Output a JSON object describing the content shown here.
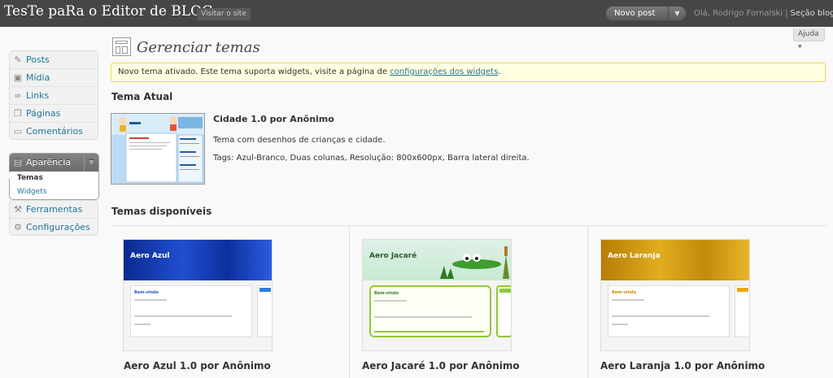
{
  "header": {
    "site_title": "TesTe paRa o Editor de BLOGs",
    "visit_site": "Visitar o site",
    "new_post": "Novo post",
    "greeting": "Olá, Rodrigo Fornalski",
    "separator": "|",
    "logout": "Seção blog"
  },
  "sidebar": {
    "items": [
      {
        "label": "Posts",
        "icon": "pin-icon"
      },
      {
        "label": "Mídia",
        "icon": "media-icon"
      },
      {
        "label": "Links",
        "icon": "links-icon"
      },
      {
        "label": "Páginas",
        "icon": "pages-icon"
      },
      {
        "label": "Comentários",
        "icon": "comments-icon"
      }
    ],
    "appearance": {
      "label": "Aparência",
      "submenu": [
        "Temas",
        "Widgets"
      ]
    },
    "bottom_items": [
      {
        "label": "Ferramentas",
        "icon": "tools-icon"
      },
      {
        "label": "Configurações",
        "icon": "settings-icon"
      }
    ]
  },
  "main": {
    "page_title": "Gerenciar temas",
    "help": "Ajuda",
    "notice": {
      "text": "Novo tema ativado. Este tema suporta widgets, visite a página de ",
      "link": "configurações dos widgets",
      "end": "."
    },
    "current_theme": {
      "heading": "Tema Atual",
      "name": "Cidade 1.0 por Anônimo",
      "description": "Tema com desenhos de crianças e cidade.",
      "tags": "Tags: Azul-Branco, Duas colunas, Resolução: 800x600px, Barra lateral direita."
    },
    "available_heading": "Temas disponíveis",
    "themes": [
      {
        "name": "Aero Azul 1.0 por Anônimo",
        "thumb_title": "Aero Azul",
        "post_title": "Bem-vindo",
        "accent": "#1a3fae"
      },
      {
        "name": "Aero Jacaré 1.0 por Anônimo",
        "thumb_title": "Aero Jacaré",
        "post_title": "Bem-vindo",
        "accent": "#8fc93a"
      },
      {
        "name": "Aero Laranja 1.0 por Anônimo",
        "thumb_title": "Aero Laranja",
        "post_title": "Bem-vindo",
        "accent": "#d49a10"
      }
    ]
  },
  "colors": {
    "header_bg": "#464646",
    "link": "#21759b",
    "notice_bg": "#ffffe0",
    "notice_border": "#e6db55"
  }
}
